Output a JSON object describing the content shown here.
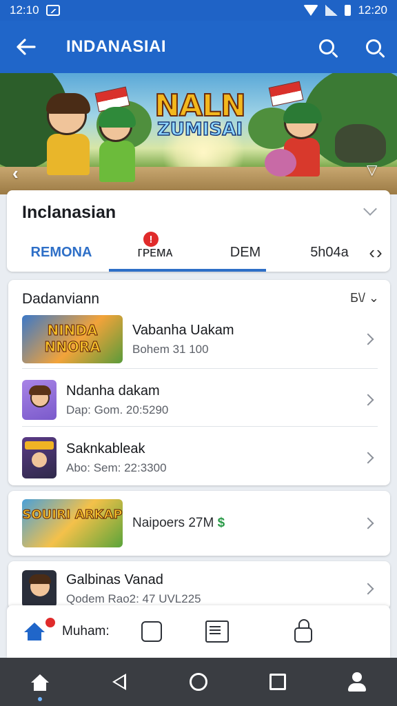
{
  "status_bar": {
    "time": "12:10",
    "clock": "12:20"
  },
  "app_bar": {
    "title": "INDANASIAI"
  },
  "banner": {
    "logo_line1": "NALN",
    "logo_line2": "ZUMISAI"
  },
  "tabs_card": {
    "heading": "Inclanasian",
    "tabs": [
      {
        "label": "REMONA"
      },
      {
        "label": "ᴦᴘᴇ᷊ᴍᴀ",
        "display": "ᴦᴘᴇᴍᴀ"
      },
      {
        "label": "DEM"
      },
      {
        "label": "5h04a"
      }
    ],
    "tab_badge": "!"
  },
  "list_card": {
    "heading": "Dadanviann",
    "filter_label": "Б\\/",
    "items": [
      {
        "title": "Vabanha Uakam",
        "subtitle": "Bohem 31 100",
        "thumb_text": "NINDA NNORA"
      },
      {
        "title": "Ndanha dakam",
        "subtitle": "Dap: Gom. 20:5290"
      },
      {
        "title": "Saknkableak",
        "subtitle": "Abo: Sem: 22:3300"
      }
    ]
  },
  "promo_card": {
    "label": "Naipoers 27M",
    "currency": "$",
    "thumb_text": "SOUIRI ARKAP"
  },
  "last_card": {
    "title": "Galbinas Vanad",
    "subtitle": "Qodem Rao2: 47 UVL225"
  },
  "action_bar": {
    "home_label": "Muham:"
  },
  "colors": {
    "primary": "#2066c9",
    "accent_tab": "#2e6fc7",
    "badge": "#e02b2b",
    "nav_bar": "#3a3d42"
  },
  "icons": [
    "back-arrow-icon",
    "search-icon",
    "home-icon",
    "box-icon",
    "news-icon",
    "lock-icon",
    "chevron-right-icon",
    "person-icon"
  ]
}
